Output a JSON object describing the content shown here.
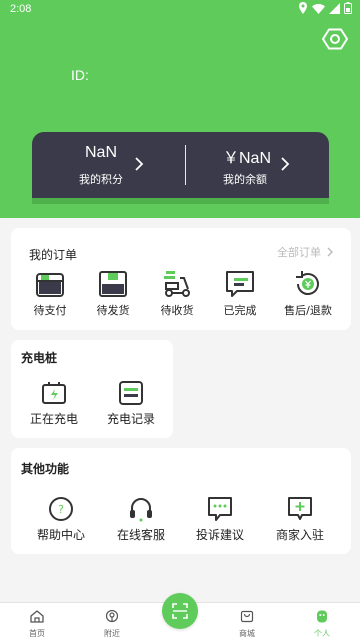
{
  "status_bar": {
    "time": "2:08"
  },
  "profile": {
    "id_label": "ID:"
  },
  "wallet": {
    "points_value": "NaN",
    "points_label": "我的积分",
    "balance_value": "￥NaN",
    "balance_label": "我的余额"
  },
  "orders": {
    "title": "我的订单",
    "all_label": "全部订单",
    "items": [
      {
        "label": "待支付",
        "icon": "wallet-icon"
      },
      {
        "label": "待发货",
        "icon": "box-icon"
      },
      {
        "label": "待收货",
        "icon": "delivery-scooter-icon"
      },
      {
        "label": "已完成",
        "icon": "message-list-icon"
      },
      {
        "label": "售后/退款",
        "icon": "refund-icon"
      }
    ]
  },
  "charging": {
    "title": "充电桩",
    "items": [
      {
        "label": "正在充电",
        "icon": "charging-icon"
      },
      {
        "label": "充电记录",
        "icon": "record-list-icon"
      }
    ]
  },
  "others": {
    "title": "其他功能",
    "items": [
      {
        "label": "帮助中心",
        "icon": "help-icon"
      },
      {
        "label": "在线客服",
        "icon": "headset-icon"
      },
      {
        "label": "投诉建议",
        "icon": "chat-bubble-icon"
      },
      {
        "label": "商家入驻",
        "icon": "add-merchant-icon"
      }
    ]
  },
  "tabbar": {
    "items": [
      {
        "label": "首页",
        "icon": "home-icon"
      },
      {
        "label": "附近",
        "icon": "location-icon"
      },
      {
        "label": "商城",
        "icon": "shop-bag-icon"
      },
      {
        "label": "个人",
        "icon": "person-icon"
      }
    ],
    "scan_icon": "scan-icon",
    "active": "个人"
  },
  "colors": {
    "brand": "#5fcb5a",
    "card_dark": "#3a3a4a",
    "background": "#f4f4f4"
  }
}
